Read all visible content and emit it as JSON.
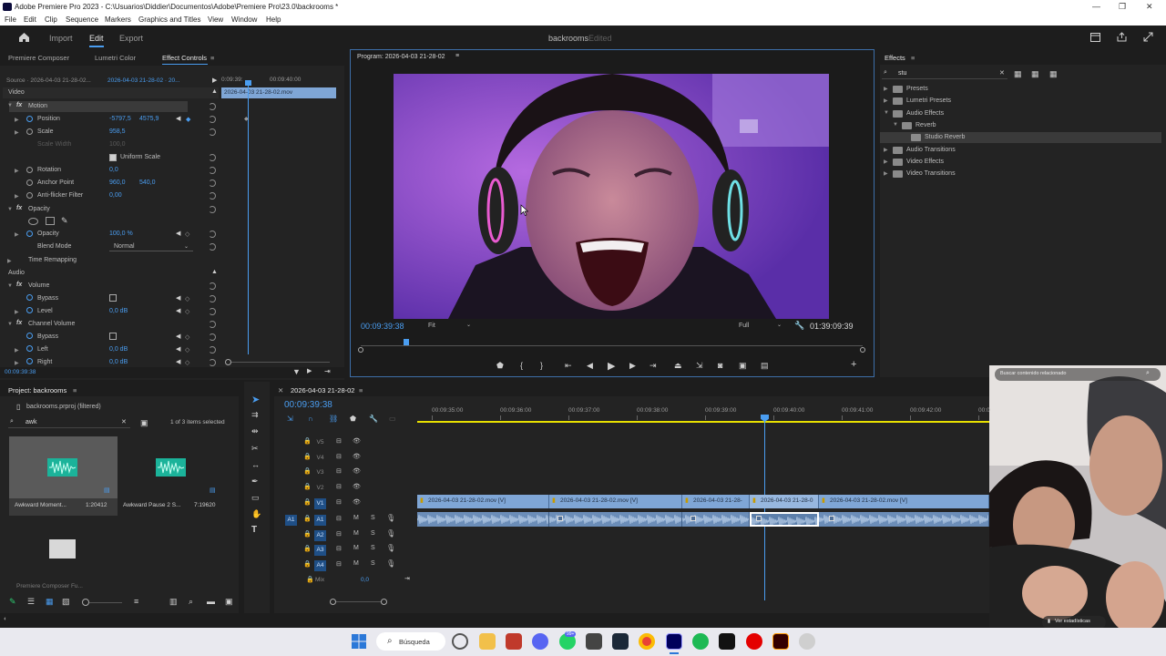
{
  "window": {
    "title": "Adobe Premiere Pro 2023 - C:\\Usuarios\\Diddier\\Documentos\\Adobe\\Premiere Pro\\23.0\\backrooms *"
  },
  "menu": [
    "File",
    "Edit",
    "Clip",
    "Sequence",
    "Markers",
    "Graphics and Titles",
    "View",
    "Window",
    "Help"
  ],
  "workspace": {
    "tabs": [
      "Import",
      "Edit",
      "Export"
    ],
    "active_tab": "Edit",
    "project_name": "backrooms",
    "status": "Edited"
  },
  "left_panel": {
    "tabs": [
      "Premiere Composer",
      "Lumetri Color",
      "Effect Controls"
    ],
    "source_label": "Source · 2026-04-03 21-28-02...",
    "sequence_label": "2026-04-03 21-28-02 · 20...",
    "mini_timecodes": [
      "0:09:39:",
      "00:09:40:00"
    ],
    "clip_label": "2026-04-03 21-28-02.mov",
    "sections": {
      "video": "Video",
      "audio": "Audio"
    },
    "effects": {
      "motion": "Motion",
      "position_label": "Position",
      "position_x": "-5797,5",
      "position_y": "4575,9",
      "scale_label": "Scale",
      "scale_value": "958,5",
      "scale_width_label": "Scale Width",
      "scale_width_value": "100,0",
      "uniform_scale": "Uniform Scale",
      "rotation_label": "Rotation",
      "rotation_value": "0,0",
      "anchor_label": "Anchor Point",
      "anchor_x": "960,0",
      "anchor_y": "540,0",
      "antiflicker_label": "Anti-flicker Filter",
      "antiflicker_value": "0,00",
      "opacity_section": "Opacity",
      "opacity_label": "Opacity",
      "opacity_value": "100,0 %",
      "blend_label": "Blend Mode",
      "blend_value": "Normal",
      "time_remap": "Time Remapping",
      "volume_section": "Volume",
      "bypass_label": "Bypass",
      "level_label": "Level",
      "level_value": "0,0 dB",
      "channel_volume": "Channel Volume",
      "left_label": "Left",
      "left_value": "0,0 dB",
      "right_label": "Right",
      "right_value": "0,0 dB"
    },
    "timecode": "00:09:39:38"
  },
  "program": {
    "title": "Program: 2026-04-03 21-28-02",
    "timecode": "00:09:39:38",
    "fit": "Fit",
    "quality": "Full",
    "duration": "01:39:09:39"
  },
  "effects_panel": {
    "title": "Effects",
    "search_value": "stu",
    "tree": [
      {
        "label": "Presets",
        "level": 0
      },
      {
        "label": "Lumetri Presets",
        "level": 0
      },
      {
        "label": "Audio Effects",
        "level": 0
      },
      {
        "label": "Reverb",
        "level": 1
      },
      {
        "label": "Studio Reverb",
        "level": 2
      },
      {
        "label": "Audio Transitions",
        "level": 0
      },
      {
        "label": "Video Effects",
        "level": 0
      },
      {
        "label": "Video Transitions",
        "level": 0
      }
    ]
  },
  "project_panel": {
    "title": "Project: backrooms",
    "file": "backrooms.prproj (filtered)",
    "search": "awk",
    "selection": "1 of 3 items selected",
    "items": [
      {
        "name": "Awkward Moment...",
        "duration": "1:20412"
      },
      {
        "name": "Awkward Pause 2 S...",
        "duration": "7:19620"
      }
    ],
    "folder_name": "Premiere Composer Fu..."
  },
  "timeline": {
    "tab": "2026-04-03 21-28-02",
    "timecode": "00:09:39:38",
    "ruler": [
      "00:09:35:00",
      "00:09:36:00",
      "00:09:37:00",
      "00:09:38:00",
      "00:09:39:00",
      "00:09:40:00",
      "00:09:41:00",
      "00:09:42:00",
      "00:0"
    ],
    "video_tracks": [
      "V5",
      "V4",
      "V3",
      "V2",
      "V1"
    ],
    "audio_tracks": [
      "A1",
      "A2",
      "A3",
      "A4"
    ],
    "source_patch": [
      "V1",
      "A1"
    ],
    "mix_label": "Mix",
    "mix_value": "0,0",
    "video_clips": [
      "2026-04-03 21-28-02.mov [V]",
      "2026-04-03 21-28-02.mov [V]",
      "2026-04-03 21-28-",
      "2026-04-03 21-28-0",
      "2026-04-03 21-28-02.mov [V]"
    ],
    "track_buttons": [
      "M",
      "S"
    ]
  },
  "overlay": {
    "search": "Buscar contenido relacionado",
    "stats": "Ver estadísticas"
  },
  "taskbar": {
    "search": "Búsqueda",
    "badge": "99+"
  }
}
